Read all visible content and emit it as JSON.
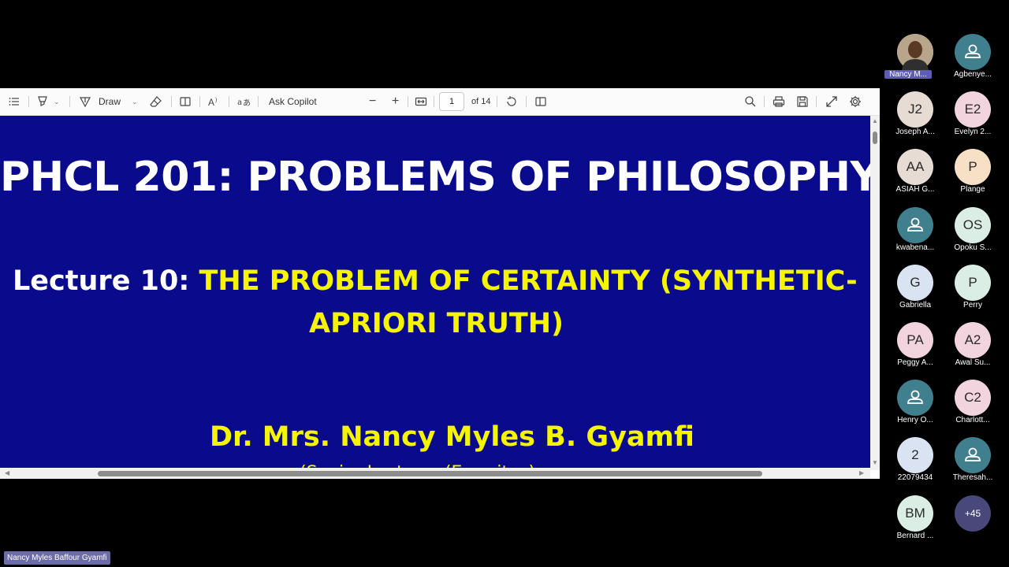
{
  "pdf": {
    "toolbar": {
      "draw_label": "Draw",
      "ask_copilot_label": "Ask Copilot",
      "page_current": "1",
      "page_total": "of 14"
    },
    "slide": {
      "title": "PHCL 201: PROBLEMS OF PHILOSOPHY",
      "lecture_prefix": "Lecture 10: ",
      "lecture_topic_line1": "THE PROBLEM OF CERTAINTY (SYNTHETIC-",
      "lecture_topic_line2": "APRIORI TRUTH)",
      "presenter": "Dr. Mrs. Nancy Myles B. Gyamfi",
      "presenter_subtitle": "(Senior Lecturer (Emeritus)"
    }
  },
  "participants": [
    {
      "initials": "",
      "name": "Nancy M...",
      "color": "#c8b49a",
      "type": "photo"
    },
    {
      "initials": "",
      "name": "Agbenye...",
      "color": "#3f7f8e",
      "type": "person"
    },
    {
      "initials": "J2",
      "name": "Joseph A...",
      "color": "#e7dcd4",
      "type": "initials"
    },
    {
      "initials": "E2",
      "name": "Evelyn 2...",
      "color": "#f1d4dd",
      "type": "initials"
    },
    {
      "initials": "AA",
      "name": "ASIAH G...",
      "color": "#e7dcd4",
      "type": "initials"
    },
    {
      "initials": "P",
      "name": "Plange",
      "color": "#f6e1c6",
      "type": "initials"
    },
    {
      "initials": "",
      "name": "kwabena...",
      "color": "#3f7f8e",
      "type": "person"
    },
    {
      "initials": "OS",
      "name": "Opoku S...",
      "color": "#dbeee6",
      "type": "initials"
    },
    {
      "initials": "G",
      "name": "Gabriella",
      "color": "#d9e3f1",
      "type": "initials"
    },
    {
      "initials": "P",
      "name": "Perry",
      "color": "#dbeee6",
      "type": "initials"
    },
    {
      "initials": "PA",
      "name": "Peggy A...",
      "color": "#f1d4dd",
      "type": "initials"
    },
    {
      "initials": "A2",
      "name": "Awal Su...",
      "color": "#f1d4dd",
      "type": "initials"
    },
    {
      "initials": "",
      "name": "Henry O...",
      "color": "#3f7f8e",
      "type": "person"
    },
    {
      "initials": "C2",
      "name": "Charlott...",
      "color": "#f1d4dd",
      "type": "initials"
    },
    {
      "initials": "2",
      "name": "22079434",
      "color": "#d9e3f1",
      "type": "initials"
    },
    {
      "initials": "",
      "name": "Theresah...",
      "color": "#3f7f8e",
      "type": "person"
    },
    {
      "initials": "BM",
      "name": "Bernard ...",
      "color": "#dbeee6",
      "type": "initials"
    },
    {
      "initials": "+45",
      "name": "",
      "color": "#48487a",
      "type": "more"
    }
  ],
  "presenter_tag": "Nancy Myles Baffour Gyamfi"
}
